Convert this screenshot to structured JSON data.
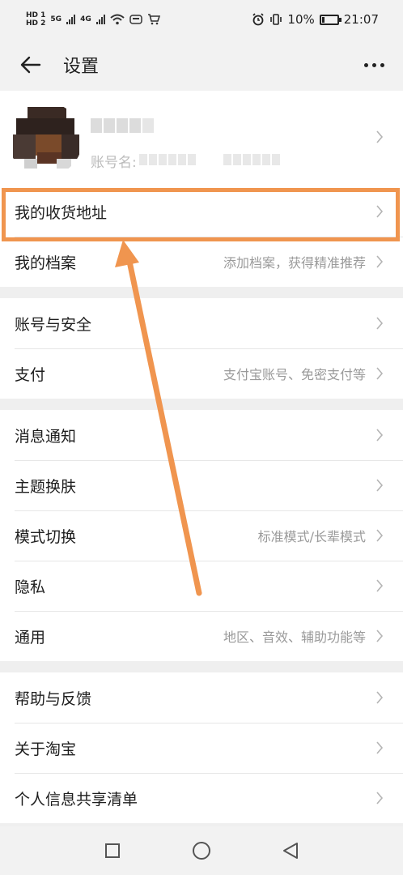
{
  "status_bar": {
    "hd1": "HD 1",
    "hd2": "HD 2",
    "net1": "5G",
    "net2": "4G",
    "battery": "10%",
    "time": "21:07"
  },
  "nav": {
    "title": "设置"
  },
  "profile": {
    "account_prefix": "账号名:"
  },
  "groups": [
    {
      "rows": [
        {
          "label": "我的收货地址",
          "sub": ""
        },
        {
          "label": "我的档案",
          "sub": "添加档案，获得精准推荐"
        }
      ]
    },
    {
      "rows": [
        {
          "label": "账号与安全",
          "sub": ""
        },
        {
          "label": "支付",
          "sub": "支付宝账号、免密支付等"
        }
      ]
    },
    {
      "rows": [
        {
          "label": "消息通知",
          "sub": ""
        },
        {
          "label": "主题换肤",
          "sub": ""
        },
        {
          "label": "模式切换",
          "sub": "标准模式/长辈模式"
        },
        {
          "label": "隐私",
          "sub": ""
        },
        {
          "label": "通用",
          "sub": "地区、音效、辅助功能等"
        }
      ]
    },
    {
      "rows": [
        {
          "label": "帮助与反馈",
          "sub": ""
        },
        {
          "label": "关于淘宝",
          "sub": ""
        },
        {
          "label": "个人信息共享清单",
          "sub": ""
        }
      ]
    }
  ],
  "colors": {
    "accent": "#f0954f",
    "background": "#efefef",
    "card": "#ffffff",
    "subtext": "#9a9a9a"
  },
  "icons": {
    "back": "arrow-left-icon",
    "more": "more-dots-icon",
    "chevron": "chevron-right-icon"
  }
}
